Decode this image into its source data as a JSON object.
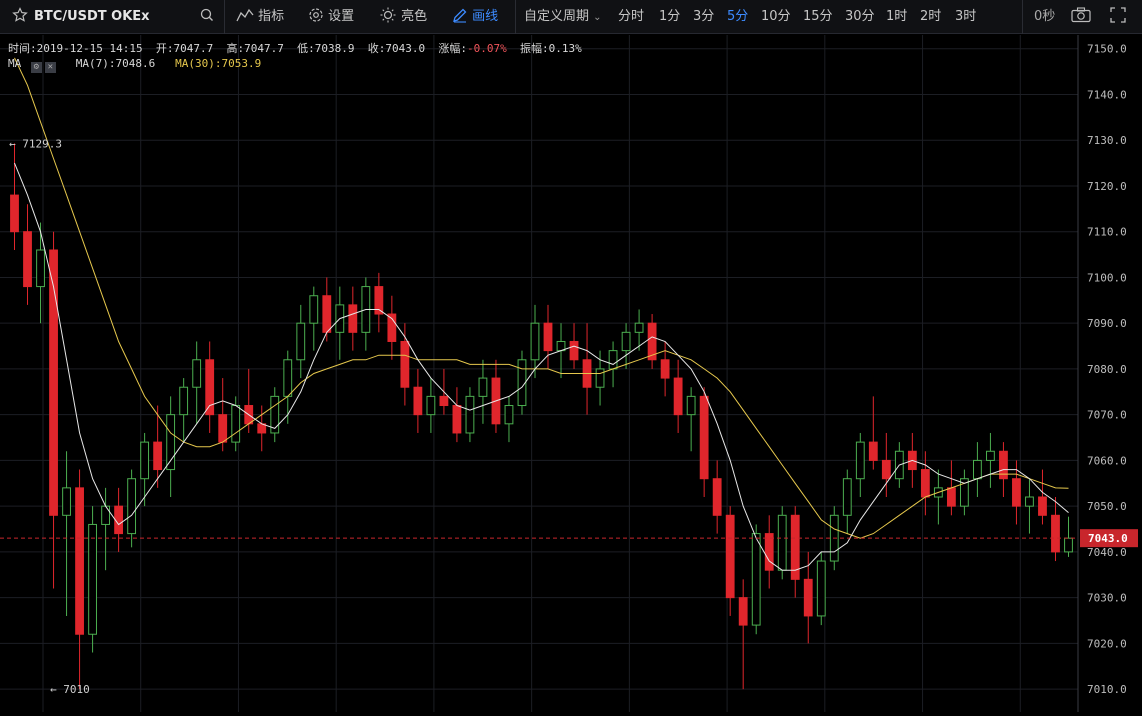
{
  "toolbar": {
    "symbol": "BTC/USDT OKEx",
    "indicators_label": "指标",
    "settings_label": "设置",
    "theme_label": "亮色",
    "draw_label": "画线",
    "custom_period_label": "自定义周期",
    "periods": [
      "分时",
      "1分",
      "3分",
      "5分",
      "10分",
      "15分",
      "30分",
      "1时",
      "2时",
      "3时"
    ],
    "active_period": "5分",
    "countdown": "0秒"
  },
  "info": {
    "time_label": "时间:",
    "time": "2019-12-15 14:15",
    "open_label": "开:",
    "open": "7047.7",
    "high_label": "高:",
    "high": "7047.7",
    "low_label": "低:",
    "low": "7038.9",
    "close_label": "收:",
    "close": "7043.0",
    "change_label": "涨幅:",
    "change": "-0.07%",
    "amplitude_label": "振幅:",
    "amplitude": "0.13%"
  },
  "ma": {
    "label": "MA",
    "ma7_label": "MA(7):",
    "ma7": "7048.6",
    "ma30_label": "MA(30):",
    "ma30": "7053.9"
  },
  "colors": {
    "up": "#4caf50",
    "down": "#e0262c",
    "ma7": "#e8e8e8",
    "ma30": "#e6c84d",
    "background": "#000000",
    "current_price_tag": "#c8262c"
  },
  "chart_data": {
    "type": "candlestick",
    "y_ticks": [
      "7010.0",
      "7020.0",
      "7030.0",
      "7040.0",
      "7050.0",
      "7060.0",
      "7070.0",
      "7080.0",
      "7090.0",
      "7100.0",
      "7110.0",
      "7120.0",
      "7130.0",
      "7140.0",
      "7150.0"
    ],
    "ylim": [
      7005,
      7153
    ],
    "current_price": "7043.0",
    "max_marker": "7129.3",
    "min_marker": "7010",
    "candles_ohlc": [
      [
        7118.0,
        7129.3,
        7106.0,
        7110.0
      ],
      [
        7110.0,
        7116.0,
        7094.0,
        7098.0
      ],
      [
        7098.0,
        7112.0,
        7090.0,
        7106.0
      ],
      [
        7106.0,
        7110.0,
        7032.0,
        7048.0
      ],
      [
        7048.0,
        7062.0,
        7026.0,
        7054.0
      ],
      [
        7054.0,
        7058.0,
        7010.0,
        7022.0
      ],
      [
        7022.0,
        7050.0,
        7018.0,
        7046.0
      ],
      [
        7046.0,
        7054.0,
        7036.0,
        7050.0
      ],
      [
        7050.0,
        7054.0,
        7040.0,
        7044.0
      ],
      [
        7044.0,
        7058.0,
        7041.0,
        7056.0
      ],
      [
        7056.0,
        7066.0,
        7050.0,
        7064.0
      ],
      [
        7064.0,
        7072.0,
        7054.0,
        7058.0
      ],
      [
        7058.0,
        7074.0,
        7052.0,
        7070.0
      ],
      [
        7070.0,
        7078.0,
        7064.0,
        7076.0
      ],
      [
        7076.0,
        7086.0,
        7068.0,
        7082.0
      ],
      [
        7082.0,
        7086.0,
        7066.0,
        7070.0
      ],
      [
        7070.0,
        7078.0,
        7062.0,
        7064.0
      ],
      [
        7064.0,
        7074.0,
        7062.0,
        7072.0
      ],
      [
        7072.0,
        7080.0,
        7066.0,
        7068.0
      ],
      [
        7068.0,
        7072.0,
        7062.0,
        7066.0
      ],
      [
        7066.0,
        7076.0,
        7064.0,
        7074.0
      ],
      [
        7074.0,
        7084.0,
        7068.0,
        7082.0
      ],
      [
        7082.0,
        7094.0,
        7078.0,
        7090.0
      ],
      [
        7090.0,
        7098.0,
        7084.0,
        7096.0
      ],
      [
        7096.0,
        7100.0,
        7086.0,
        7088.0
      ],
      [
        7088.0,
        7098.0,
        7082.0,
        7094.0
      ],
      [
        7094.0,
        7098.0,
        7084.0,
        7088.0
      ],
      [
        7088.0,
        7100.0,
        7084.0,
        7098.0
      ],
      [
        7098.0,
        7101.0,
        7088.0,
        7092.0
      ],
      [
        7092.0,
        7096.0,
        7082.0,
        7086.0
      ],
      [
        7086.0,
        7090.0,
        7072.0,
        7076.0
      ],
      [
        7076.0,
        7080.0,
        7066.0,
        7070.0
      ],
      [
        7070.0,
        7078.0,
        7066.0,
        7074.0
      ],
      [
        7074.0,
        7080.0,
        7070.0,
        7072.0
      ],
      [
        7072.0,
        7076.0,
        7064.0,
        7066.0
      ],
      [
        7066.0,
        7076.0,
        7064.0,
        7074.0
      ],
      [
        7074.0,
        7082.0,
        7068.0,
        7078.0
      ],
      [
        7078.0,
        7082.0,
        7066.0,
        7068.0
      ],
      [
        7068.0,
        7074.0,
        7064.0,
        7072.0
      ],
      [
        7072.0,
        7084.0,
        7070.0,
        7082.0
      ],
      [
        7082.0,
        7094.0,
        7078.0,
        7090.0
      ],
      [
        7090.0,
        7094.0,
        7080.0,
        7084.0
      ],
      [
        7084.0,
        7090.0,
        7078.0,
        7086.0
      ],
      [
        7086.0,
        7090.0,
        7080.0,
        7082.0
      ],
      [
        7082.0,
        7090.0,
        7070.0,
        7076.0
      ],
      [
        7076.0,
        7084.0,
        7072.0,
        7080.0
      ],
      [
        7080.0,
        7086.0,
        7076.0,
        7084.0
      ],
      [
        7084.0,
        7090.0,
        7080.0,
        7088.0
      ],
      [
        7088.0,
        7093.0,
        7084.0,
        7090.0
      ],
      [
        7090.0,
        7092.0,
        7080.0,
        7082.0
      ],
      [
        7082.0,
        7086.0,
        7074.0,
        7078.0
      ],
      [
        7078.0,
        7082.0,
        7066.0,
        7070.0
      ],
      [
        7070.0,
        7076.0,
        7062.0,
        7074.0
      ],
      [
        7074.0,
        7076.0,
        7052.0,
        7056.0
      ],
      [
        7056.0,
        7060.0,
        7044.0,
        7048.0
      ],
      [
        7048.0,
        7050.0,
        7026.0,
        7030.0
      ],
      [
        7030.0,
        7034.0,
        7010.0,
        7024.0
      ],
      [
        7024.0,
        7046.0,
        7022.0,
        7044.0
      ],
      [
        7044.0,
        7048.0,
        7032.0,
        7036.0
      ],
      [
        7036.0,
        7050.0,
        7034.0,
        7048.0
      ],
      [
        7048.0,
        7050.0,
        7030.0,
        7034.0
      ],
      [
        7034.0,
        7040.0,
        7020.0,
        7026.0
      ],
      [
        7026.0,
        7040.0,
        7024.0,
        7038.0
      ],
      [
        7038.0,
        7050.0,
        7036.0,
        7048.0
      ],
      [
        7048.0,
        7058.0,
        7044.0,
        7056.0
      ],
      [
        7056.0,
        7066.0,
        7052.0,
        7064.0
      ],
      [
        7064.0,
        7074.0,
        7058.0,
        7060.0
      ],
      [
        7060.0,
        7066.0,
        7052.0,
        7056.0
      ],
      [
        7056.0,
        7064.0,
        7054.0,
        7062.0
      ],
      [
        7062.0,
        7066.0,
        7054.0,
        7058.0
      ],
      [
        7058.0,
        7062.0,
        7048.0,
        7052.0
      ],
      [
        7052.0,
        7058.0,
        7046.0,
        7054.0
      ],
      [
        7054.0,
        7060.0,
        7048.0,
        7050.0
      ],
      [
        7050.0,
        7058.0,
        7048.0,
        7056.0
      ],
      [
        7056.0,
        7064.0,
        7052.0,
        7060.0
      ],
      [
        7060.0,
        7066.0,
        7054.0,
        7062.0
      ],
      [
        7062.0,
        7064.0,
        7052.0,
        7056.0
      ],
      [
        7056.0,
        7060.0,
        7046.0,
        7050.0
      ],
      [
        7050.0,
        7056.0,
        7044.0,
        7052.0
      ],
      [
        7052.0,
        7058.0,
        7046.0,
        7048.0
      ],
      [
        7048.0,
        7052.0,
        7038.0,
        7040.0
      ],
      [
        7040.0,
        7047.7,
        7038.9,
        7043.0
      ]
    ],
    "ma7": [
      7125,
      7118,
      7110,
      7098,
      7082,
      7066,
      7056,
      7050,
      7046,
      7048,
      7052,
      7056,
      7060,
      7064,
      7068,
      7072,
      7073,
      7072,
      7070,
      7068,
      7067,
      7070,
      7075,
      7082,
      7088,
      7091,
      7092,
      7093,
      7093,
      7091,
      7087,
      7082,
      7078,
      7075,
      7072,
      7071,
      7072,
      7073,
      7074,
      7076,
      7080,
      7083,
      7084,
      7085,
      7084,
      7082,
      7081,
      7083,
      7085,
      7087,
      7086,
      7083,
      7080,
      7075,
      7068,
      7060,
      7050,
      7043,
      7038,
      7036,
      7036,
      7037,
      7040,
      7040,
      7042,
      7047,
      7051,
      7055,
      7059,
      7060,
      7059,
      7057,
      7056,
      7055,
      7056,
      7057,
      7058,
      7058,
      7056,
      7053,
      7051,
      7048.6
    ],
    "ma30": [
      7148,
      7142,
      7134,
      7126,
      7118,
      7110,
      7102,
      7094,
      7086,
      7080,
      7074,
      7070,
      7066,
      7064,
      7063,
      7063,
      7064,
      7066,
      7068,
      7070,
      7072,
      7074,
      7077,
      7079,
      7080,
      7081,
      7082,
      7082,
      7083,
      7083,
      7083,
      7082,
      7082,
      7082,
      7082,
      7081,
      7081,
      7081,
      7081,
      7080,
      7080,
      7080,
      7079,
      7079,
      7079,
      7079,
      7080,
      7081,
      7082,
      7083,
      7084,
      7083,
      7082,
      7080,
      7078,
      7075,
      7071,
      7067,
      7063,
      7059,
      7055,
      7051,
      7047,
      7045,
      7044,
      7043,
      7044,
      7046,
      7048,
      7050,
      7052,
      7053,
      7054,
      7055,
      7056,
      7057,
      7057,
      7057,
      7056,
      7055,
      7054,
      7053.9
    ]
  }
}
